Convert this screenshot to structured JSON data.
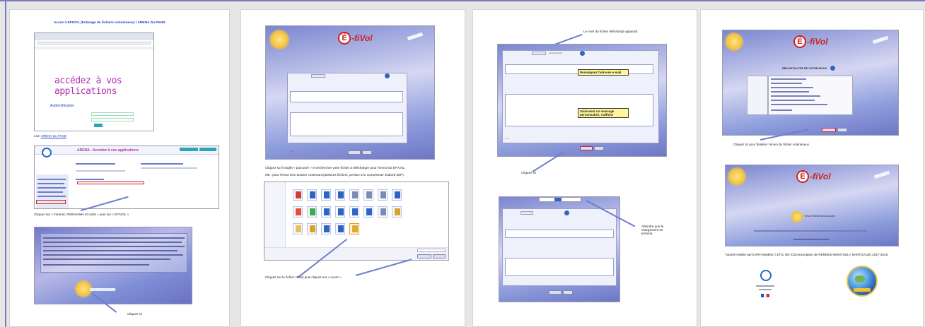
{
  "page1": {
    "title": "Accès à EFIVOL (Echange de fichiers volumineux) / ARENA Du PAND",
    "portal_heading": "accédez à vos applications",
    "auth_label": "Authentification",
    "link_caption_prefix": "Lien",
    "link_caption_link": "ARENA Du PAND",
    "arena_title": "ARENA - Accédez à vos applications",
    "caption_intranet": "Cliquez sur « Intranet, Référentiels et outils » puis sur « EFIVOL »",
    "caption_click": "Cliquez ici"
  },
  "page2": {
    "caption_browse": "Cliquez sur l'onglet « parcourir » et rechercher votre fichier à télécharger pour l'envoi sur EFIVOL",
    "caption_nb": "NB : pour l'envoi d'un dossier contenant plusieurs fichiers, pensez à le compresser d'abord (ZIP).",
    "caption_open": "Cliquez sur le fichier choisi puis cliquez sur « ouvrir »"
  },
  "page3": {
    "caption_file_name": "Le nom du fichier téléchargé apparaît.",
    "callout_email": "Renseignez l'adresse e-mail",
    "callout_message": "Saisissant un message personnalisé, s'affiche",
    "caption_click": "Cliquez ici",
    "caption_watch": "Attendre que le chargement se termine."
  },
  "page4": {
    "caption_send": "Cliquez ici pour finaliser l'envoi du fichier volumineux",
    "send_message": "Envoi terminé avec succès",
    "tutorial_credit": "Tutoriel réalisé par EVRH Médéric / ETIC NE (Circonscription de RENNES-MONTGELY NANTGAUD) 2017-2018",
    "recap_title": "RÉCAPITULATIF DE VOTRE ENVOI"
  },
  "brand": {
    "logo_letter": "É",
    "logo_word": "-fiVol",
    "accent": "#cc2222",
    "link_color": "#1a3fbf",
    "frame_color": "#7b7bb8"
  }
}
